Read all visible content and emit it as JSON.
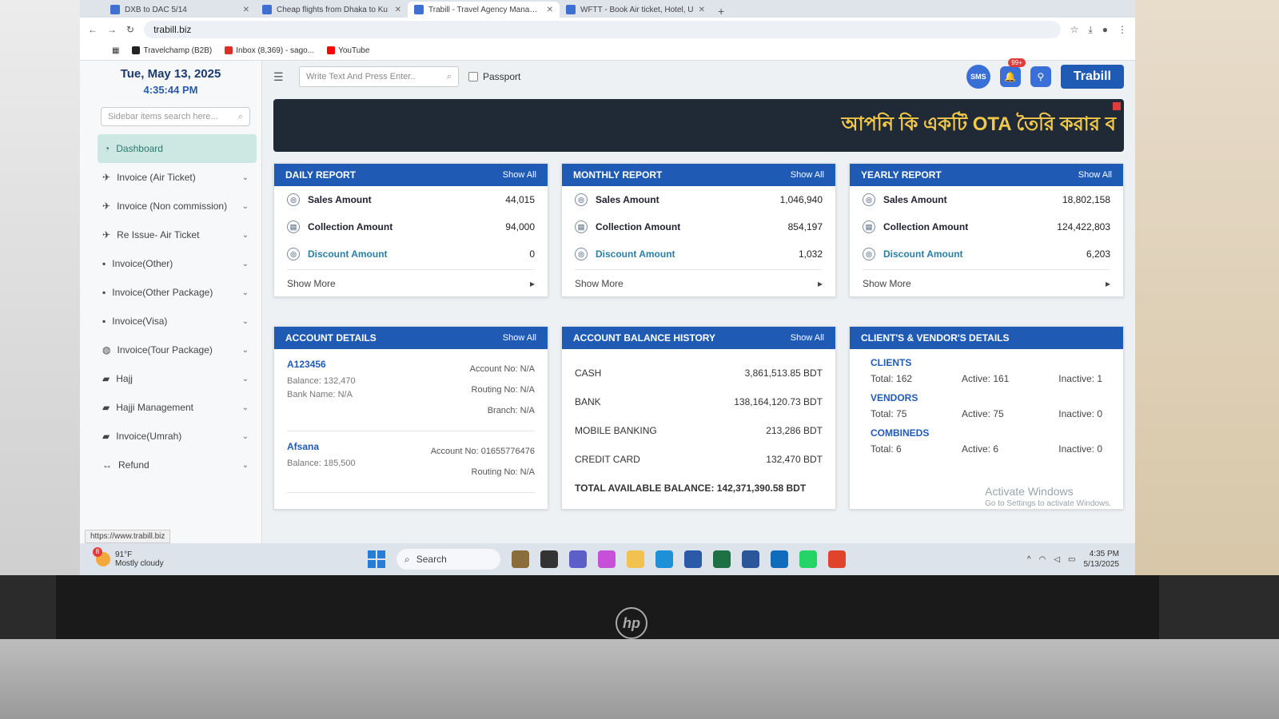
{
  "browser": {
    "tabs": [
      {
        "title": "DXB to DAC 5/14",
        "active": false
      },
      {
        "title": "Cheap flights from Dhaka to Ku",
        "active": false
      },
      {
        "title": "Trabill - Travel Agency Managem",
        "active": true
      },
      {
        "title": "WFTT - Book Air ticket, Hotel, U",
        "active": false
      }
    ],
    "url": "trabill.biz",
    "bookmarks": [
      {
        "label": "Travelchamp (B2B)",
        "color": "#222222"
      },
      {
        "label": "Inbox (8,369) - sago...",
        "color": "#d93025"
      },
      {
        "label": "YouTube",
        "color": "#ff0000"
      }
    ]
  },
  "sidebar": {
    "date": "Tue, May 13, 2025",
    "time": "4:35:44 PM",
    "search_placeholder": "Sidebar items search here...",
    "items": [
      {
        "label": "Dashboard",
        "icon": "dashboard-icon",
        "active": true
      },
      {
        "label": "Invoice (Air Ticket)",
        "icon": "plane-icon"
      },
      {
        "label": "Invoice (Non commission)",
        "icon": "plane-icon"
      },
      {
        "label": "Re Issue- Air Ticket",
        "icon": "plane-icon"
      },
      {
        "label": "Invoice(Other)",
        "icon": "document-icon"
      },
      {
        "label": "Invoice(Other Package)",
        "icon": "document-icon"
      },
      {
        "label": "Invoice(Visa)",
        "icon": "document-icon"
      },
      {
        "label": "Invoice(Tour Package)",
        "icon": "globe-icon"
      },
      {
        "label": "Hajj",
        "icon": "kaaba-icon"
      },
      {
        "label": "Hajji Management",
        "icon": "kaaba-icon"
      },
      {
        "label": "Invoice(Umrah)",
        "icon": "kaaba-icon"
      },
      {
        "label": "Refund",
        "icon": "refund-icon"
      }
    ],
    "status_url": "https://www.trabill.biz"
  },
  "topbar": {
    "search_placeholder": "Write Text And Press Enter..",
    "passport_label": "Passport",
    "sms_label": "SMS",
    "notification_badge": "99+",
    "brand": "Trabill"
  },
  "banner": {
    "text": "আপনি কি একটি OTA তৈরি করার ব"
  },
  "reports": [
    {
      "title": "DAILY REPORT",
      "show_all": "Show All",
      "sales_label": "Sales Amount",
      "sales": "44,015",
      "collection_label": "Collection Amount",
      "collection": "94,000",
      "discount_label": "Discount Amount",
      "discount": "0",
      "more": "Show More"
    },
    {
      "title": "MONTHLY REPORT",
      "show_all": "Show All",
      "sales_label": "Sales Amount",
      "sales": "1,046,940",
      "collection_label": "Collection Amount",
      "collection": "854,197",
      "discount_label": "Discount Amount",
      "discount": "1,032",
      "more": "Show More"
    },
    {
      "title": "YEARLY REPORT",
      "show_all": "Show All",
      "sales_label": "Sales Amount",
      "sales": "18,802,158",
      "collection_label": "Collection Amount",
      "collection": "124,422,803",
      "discount_label": "Discount Amount",
      "discount": "6,203",
      "more": "Show More"
    }
  ],
  "account_details": {
    "title": "ACCOUNT DETAILS",
    "show_all": "Show All",
    "accounts": [
      {
        "name": "A123456",
        "balance": "Balance: 132,470",
        "bank": "Bank Name: N/A",
        "account_no": "Account No: N/A",
        "routing": "Routing No: N/A",
        "branch": "Branch: N/A"
      },
      {
        "name": "Afsana",
        "balance": "Balance: 185,500",
        "bank": "",
        "account_no": "Account No: 01655776476",
        "routing": "Routing No: N/A",
        "branch": ""
      }
    ]
  },
  "balance_history": {
    "title": "ACCOUNT BALANCE HISTORY",
    "show_all": "Show All",
    "rows": [
      {
        "label": "CASH",
        "value": "3,861,513.85 BDT"
      },
      {
        "label": "BANK",
        "value": "138,164,120.73 BDT"
      },
      {
        "label": "MOBILE BANKING",
        "value": "213,286 BDT"
      },
      {
        "label": "CREDIT CARD",
        "value": "132,470 BDT"
      }
    ],
    "total": "TOTAL AVAILABLE BALANCE: 142,371,390.58 BDT"
  },
  "clients_vendors": {
    "title": "CLIENT'S & VENDOR'S DETAILS",
    "sections": [
      {
        "title": "CLIENTS",
        "total": "Total: 162",
        "active": "Active: 161",
        "inactive": "Inactive: 1"
      },
      {
        "title": "VENDORS",
        "total": "Total: 75",
        "active": "Active: 75",
        "inactive": "Inactive: 0"
      },
      {
        "title": "COMBINEDS",
        "total": "Total: 6",
        "active": "Active: 6",
        "inactive": "Inactive: 0"
      }
    ]
  },
  "activate_windows": {
    "title": "Activate Windows",
    "sub": "Go to Settings to activate Windows."
  },
  "taskbar": {
    "weather_badge": "8",
    "temp": "91°F",
    "weather": "Mostly cloudy",
    "search": "Search",
    "time": "4:35 PM",
    "date": "5/13/2025"
  },
  "colors": {
    "primary": "#1f5bb5",
    "active_sidebar": "#cde7e2",
    "banner_bg": "#1f2a36",
    "banner_text": "#f3c84b"
  }
}
